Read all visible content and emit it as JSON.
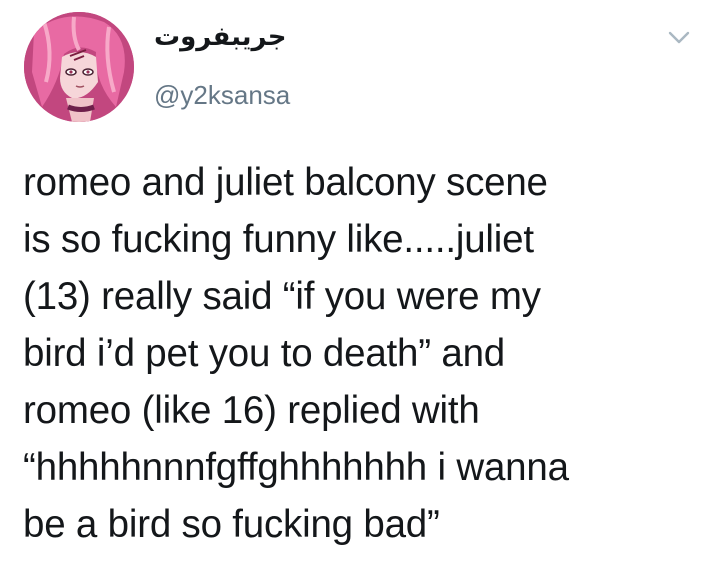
{
  "tweet": {
    "display_name": "جريبفروت",
    "handle": "@y2ksansa",
    "text": "romeo and juliet balcony scene\nis so fucking funny like.....juliet\n(13) really said “if you were my\nbird i’d pet you to death” and\nromeo (like 16) replied with\n“hhhhhnnnfgffghhhhhhh i wanna\nbe a bird so fucking bad”"
  },
  "icons": {
    "more_options": "chevron-down-icon",
    "avatar": "anime-character-avatar"
  },
  "colors": {
    "text_primary": "#14171a",
    "text_secondary": "#657786",
    "background": "#ffffff",
    "chevron": "#aab8c2"
  }
}
